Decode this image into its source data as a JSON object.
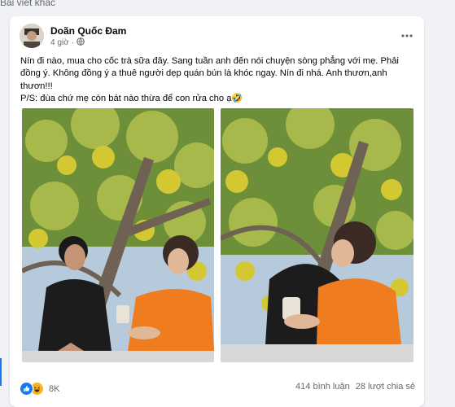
{
  "section": {
    "title": "Bài viết khác"
  },
  "post": {
    "author": "Doãn Quốc Đam",
    "time": "4 giờ",
    "time_separator": "·",
    "privacy_icon": "globe-icon",
    "more_icon": "more-horizontal-icon",
    "text_lines": [
      "Nín đi nào, mua cho cốc trà sữa đây. Sang tuần anh đến nói chuyện sòng phẳng với mẹ. Phải",
      "đồng ý. Không đồng ý a thuê người dẹp quán bún là khóc ngay. Nín đi nhá. Anh thươn,anh",
      "thươn!!!",
      "P/S: đùa chứ mẹ còn bát nào thừa để con rửa cho ạ🤣"
    ],
    "photos": [
      "photo-couple-tree",
      "photo-couple-hug"
    ],
    "reactions": {
      "icons": [
        "like-icon",
        "haha-icon"
      ],
      "count": "8K",
      "comments": "414 bình luận",
      "shares": "28 lượt chia sẻ"
    },
    "colors": {
      "like": "#1877f2",
      "haha": "#f7b125",
      "secondary_text": "#65676b"
    }
  }
}
